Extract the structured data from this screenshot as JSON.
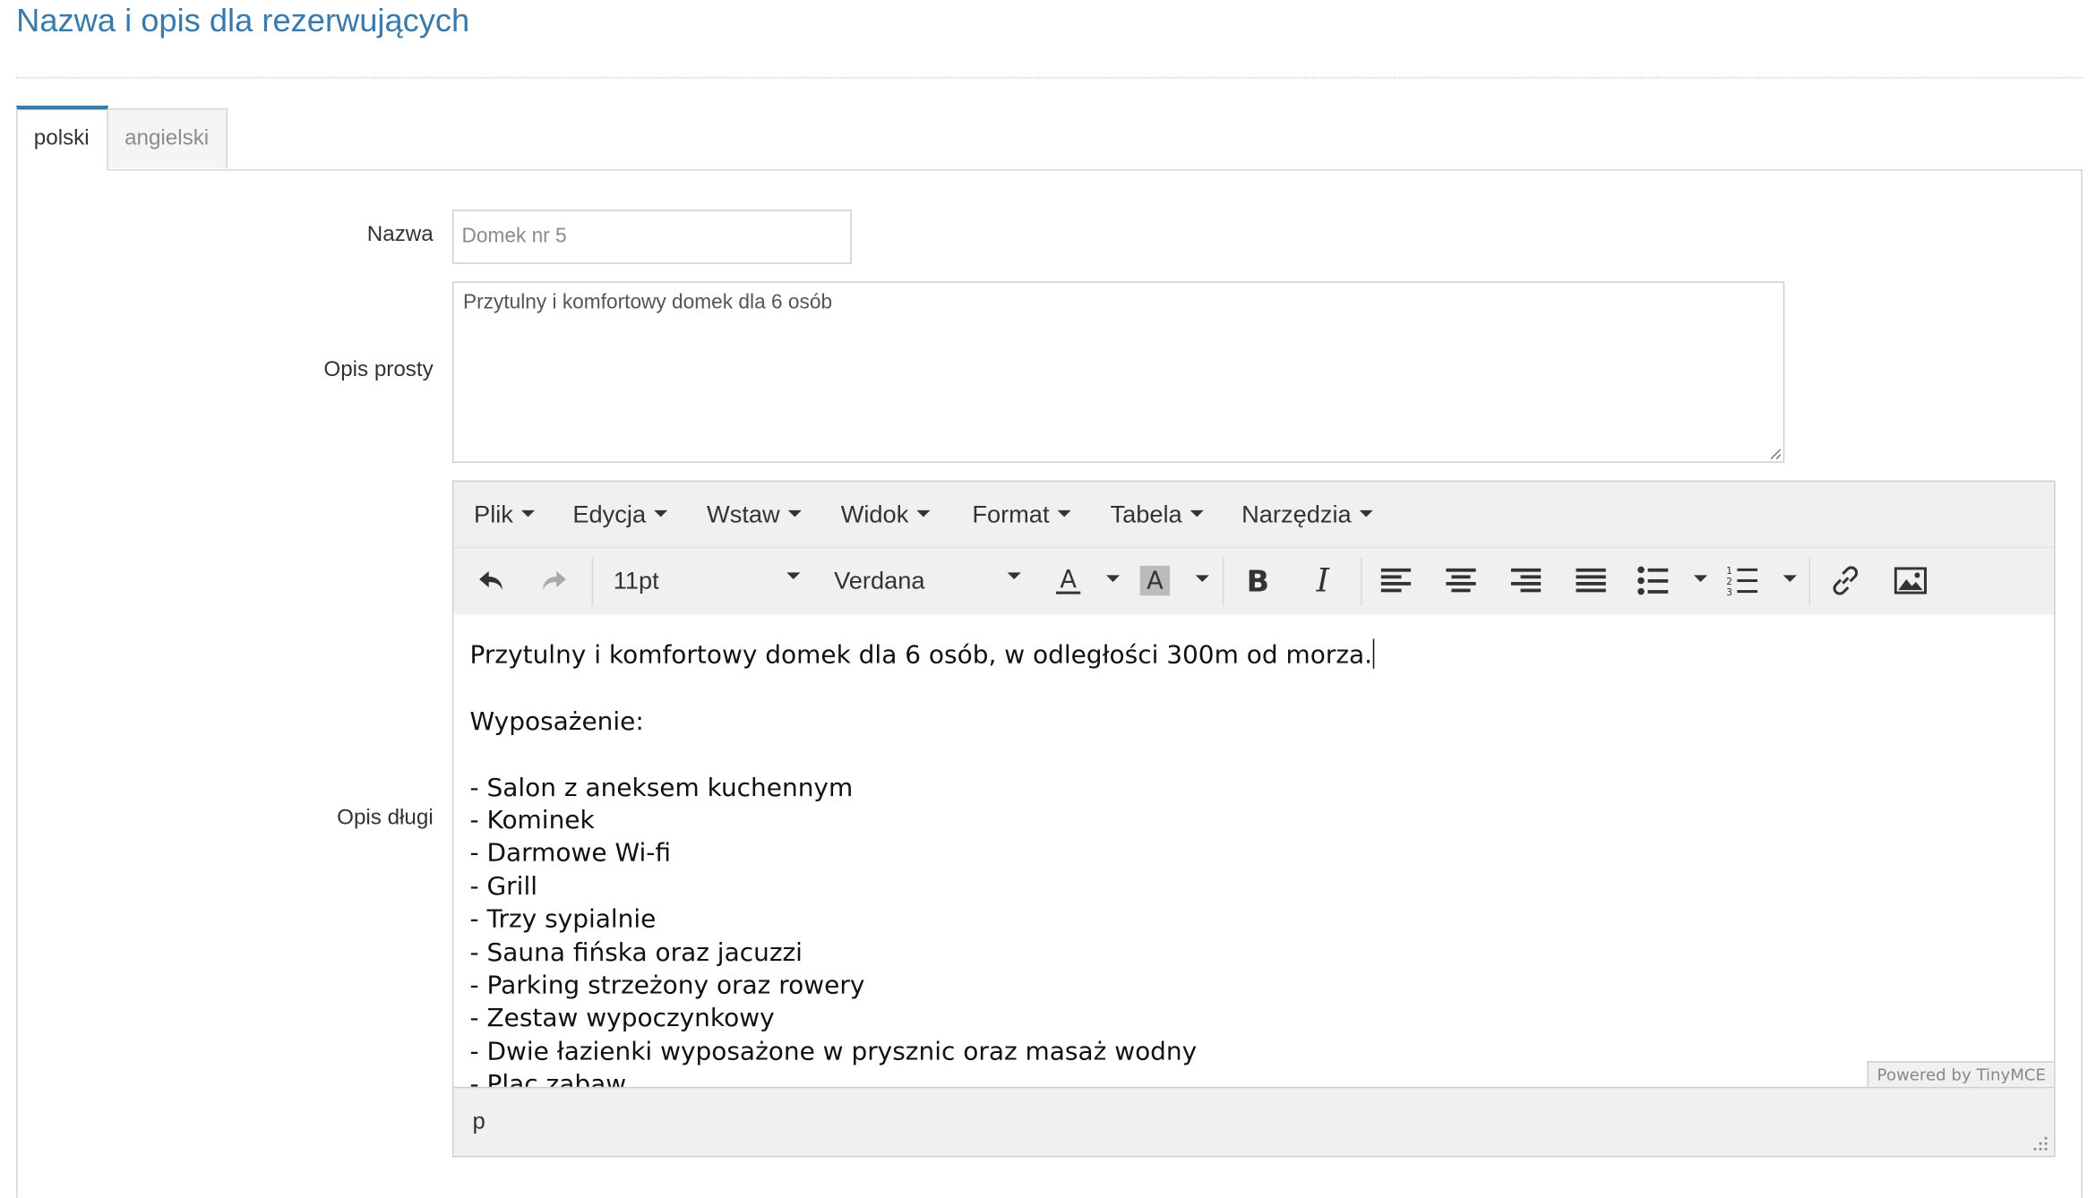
{
  "section_title": "Nazwa i opis dla rezerwujących",
  "tabs": [
    {
      "label": "polski",
      "active": true
    },
    {
      "label": "angielski",
      "active": false
    }
  ],
  "form": {
    "name_label": "Nazwa",
    "name_value": "Domek nr 5",
    "short_desc_label": "Opis prosty",
    "short_desc_value": "Przytulny i komfortowy domek dla 6 osób",
    "long_desc_label": "Opis długi"
  },
  "editor": {
    "menu": [
      "Plik",
      "Edycja",
      "Wstaw",
      "Widok",
      "Format",
      "Tabela",
      "Narzędzia"
    ],
    "font_size": "11pt",
    "font_family": "Verdana",
    "content_lines": [
      "Przytulny i komfortowy domek dla 6 osób, w odległości 300m od morza.",
      "",
      "Wyposażenie:",
      "",
      "- Salon z aneksem kuchennym",
      "- Kominek",
      "- Darmowe Wi-fi",
      "- Grill",
      "- Trzy sypialnie",
      "- Sauna fińska oraz jacuzzi",
      "- Parking strzeżony oraz rowery",
      "- Zestaw wypoczynkowy",
      "- Dwie łazienki wyposażone w prysznic oraz masaż wodny",
      "- Plac zabaw"
    ],
    "powered_by": "Powered by TinyMCE",
    "status_path": "p"
  },
  "icons": [
    "undo-icon",
    "redo-icon",
    "text-color-icon",
    "background-color-icon",
    "bold-icon",
    "italic-icon",
    "align-left-icon",
    "align-center-icon",
    "align-right-icon",
    "align-justify-icon",
    "bullet-list-icon",
    "numbered-list-icon",
    "link-icon",
    "image-icon",
    "resize-grip-icon"
  ],
  "colors": {
    "accent": "#3a7aaa",
    "editor_chrome": "#f0f0f0",
    "border": "#cfcfcf"
  }
}
